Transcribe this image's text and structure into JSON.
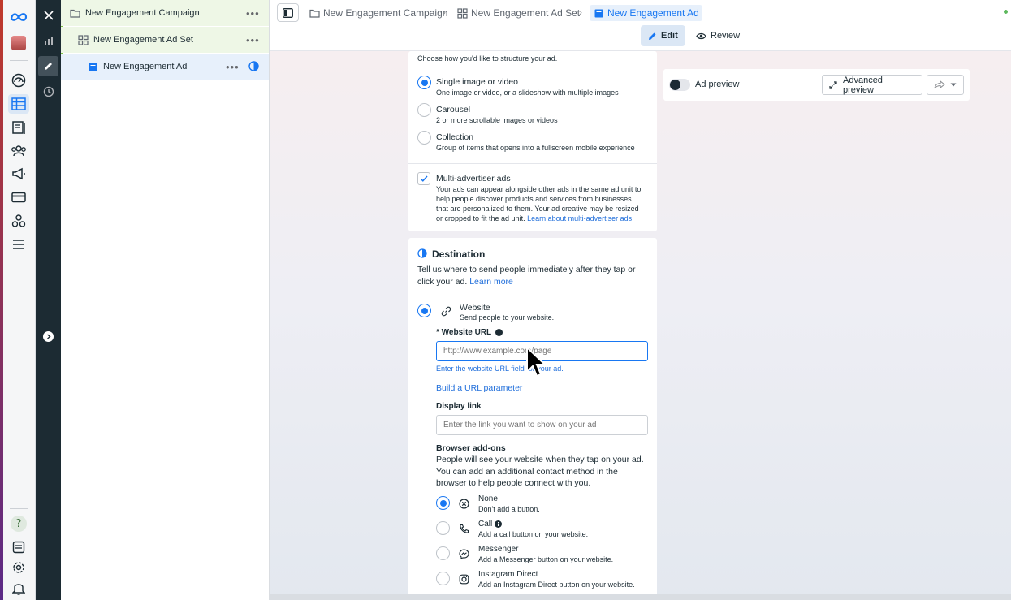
{
  "tree": {
    "campaign_label": "New Engagement Campaign",
    "adset_label": "New Engagement Ad Set",
    "ad_label": "New Engagement Ad",
    "more_glyph": "•••"
  },
  "breadcrumb": {
    "campaign": "New Engagement Campaign",
    "adset": "New Engagement Ad Set",
    "ad": "New Engagement Ad",
    "separator": "›"
  },
  "modes": {
    "edit": "Edit",
    "review": "Review"
  },
  "format": {
    "intro": "Choose how you'd like to structure your ad.",
    "options": [
      {
        "label": "Single image or video",
        "desc": "One image or video, or a slideshow with multiple images",
        "selected": true
      },
      {
        "label": "Carousel",
        "desc": "2 or more scrollable images or videos",
        "selected": false
      },
      {
        "label": "Collection",
        "desc": "Group of items that opens into a fullscreen mobile experience",
        "selected": false
      }
    ],
    "multi_advertiser": {
      "label": "Multi-advertiser ads",
      "lines": [
        "Your ads can appear alongside other ads in the same ad unit to",
        "help people discover products and services from businesses",
        "that are personalized to them. Your ad creative may be resized"
      ],
      "last_line_prefix": "or cropped to fit the ad unit. ",
      "link": "Learn about multi-advertiser ads",
      "checked": true
    }
  },
  "destination": {
    "title": "Destination",
    "line1": "Tell us where to send people immediately after they tap or",
    "line2_prefix": "click your ad. ",
    "learn_more": "Learn more",
    "website_label": "Website",
    "website_desc": "Send people to your website.",
    "url_label": "* Website URL",
    "url_placeholder": "http://www.example.com/page",
    "url_error": "Enter the website URL field for your ad.",
    "url_param_link": "Build a URL parameter",
    "display_link_label": "Display link",
    "display_link_placeholder": "Enter the link you want to show on your ad",
    "addons_title": "Browser add-ons",
    "addons_lines": [
      "People will see your website when they tap on your ad.",
      "You can add an additional contact method in the",
      "browser to help people connect with you."
    ],
    "addons": [
      {
        "label": "None",
        "desc": "Don't add a button.",
        "icon": "x-circle-icon",
        "selected": true
      },
      {
        "label": "Call",
        "desc": "Add a call button on your website.",
        "icon": "phone-icon",
        "selected": false
      },
      {
        "label": "Messenger",
        "desc": "Add a Messenger button on your website.",
        "icon": "messenger-icon",
        "selected": false
      },
      {
        "label": "Instagram Direct",
        "desc": "Add an Instagram Direct button on your website.",
        "icon": "instagram-icon",
        "selected": false
      }
    ]
  },
  "preview": {
    "toggle_label": "Ad preview",
    "advanced": "Advanced preview"
  },
  "colors": {
    "accent": "#1877f2",
    "campaign_green": "#7cc242",
    "dark_strip": "#1c2b33"
  }
}
